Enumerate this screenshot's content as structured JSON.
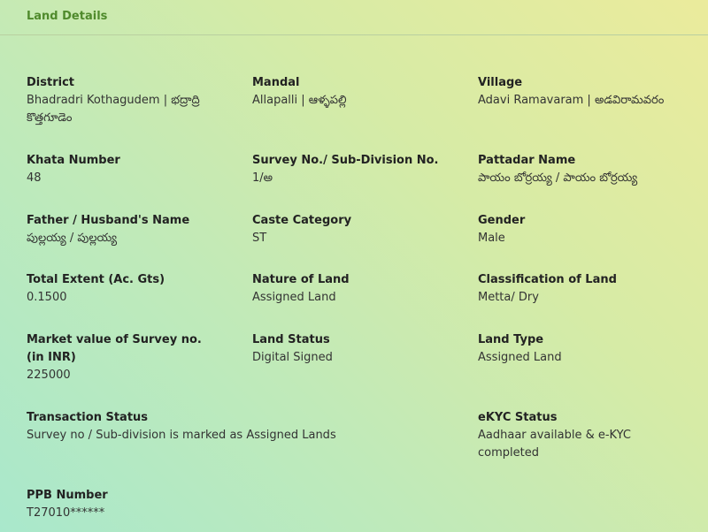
{
  "header": {
    "title": "Land Details"
  },
  "fields": {
    "district": {
      "label": "District",
      "value": "Bhadradri Kothagudem | భద్రాద్రి కొత్తగూడెం"
    },
    "mandal": {
      "label": "Mandal",
      "value": "Allapalli | ఆళ్ళపల్లి"
    },
    "village": {
      "label": "Village",
      "value": "Adavi Ramavaram | అడవిరామవరం"
    },
    "khata_number": {
      "label": "Khata Number",
      "value": "48"
    },
    "survey_no": {
      "label": "Survey No./ Sub-Division No.",
      "value": "1/అ"
    },
    "pattadar_name": {
      "label": "Pattadar Name",
      "value": "పాయం బోర్రయ్య / పాయం బోర్రయ్య"
    },
    "father_husband_name": {
      "label": "Father / Husband's Name",
      "value": "పుల్లయ్య / పుల్లయ్య"
    },
    "caste_category": {
      "label": "Caste Category",
      "value": "ST"
    },
    "gender": {
      "label": "Gender",
      "value": "Male"
    },
    "total_extent": {
      "label": "Total Extent (Ac. Gts)",
      "value": "0.1500"
    },
    "nature_of_land": {
      "label": "Nature of Land",
      "value": "Assigned Land"
    },
    "classification_of_land": {
      "label": "Classification of Land",
      "value": "Metta/ Dry"
    },
    "market_value": {
      "label": "Market value of Survey no.(in INR)",
      "value": "225000"
    },
    "land_status": {
      "label": "Land Status",
      "value": "Digital Signed"
    },
    "land_type": {
      "label": "Land Type",
      "value": "Assigned Land"
    },
    "transaction_status": {
      "label": "Transaction Status",
      "value": "Survey no / Sub-division is marked as Assigned Lands"
    },
    "ekyc_status": {
      "label": "eKYC Status",
      "value": "Aadhaar available & e-KYC completed"
    },
    "ppb_number": {
      "label": "PPB Number",
      "value": "T27010******"
    }
  }
}
